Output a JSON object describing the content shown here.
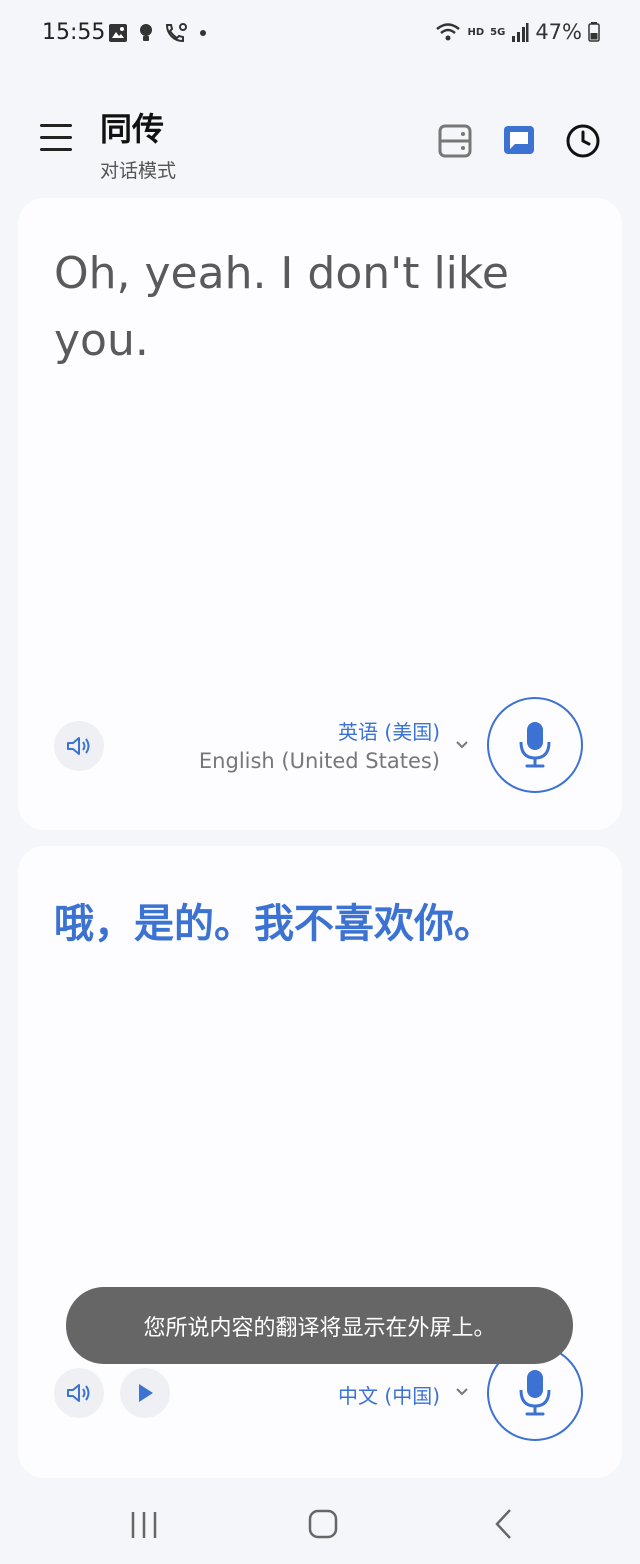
{
  "status_bar": {
    "time": "15:55",
    "battery": "47%",
    "network_badges": [
      "HD",
      "5G"
    ]
  },
  "app_bar": {
    "title": "同传",
    "subtitle": "对话模式"
  },
  "source_panel": {
    "text": "Oh, yeah. I don't like you.",
    "language_native": "英语 (美国)",
    "language_english": "English (United States)"
  },
  "target_panel": {
    "text": "哦，是的。我不喜欢你。",
    "language_native": "中文 (中国)"
  },
  "toast": {
    "message": "您所说内容的翻译将显示在外屏上。"
  },
  "colors": {
    "accent": "#3c72d2",
    "background": "#f5f6f9",
    "card": "#fdfdff",
    "toast": "#666666"
  },
  "icons": {
    "menu": "menu-icon",
    "split_view": "split-view-icon",
    "chat": "chat-icon",
    "history": "history-icon",
    "speaker": "speaker-icon",
    "play": "play-icon",
    "mic": "mic-icon",
    "chevron": "chevron-down-icon"
  }
}
